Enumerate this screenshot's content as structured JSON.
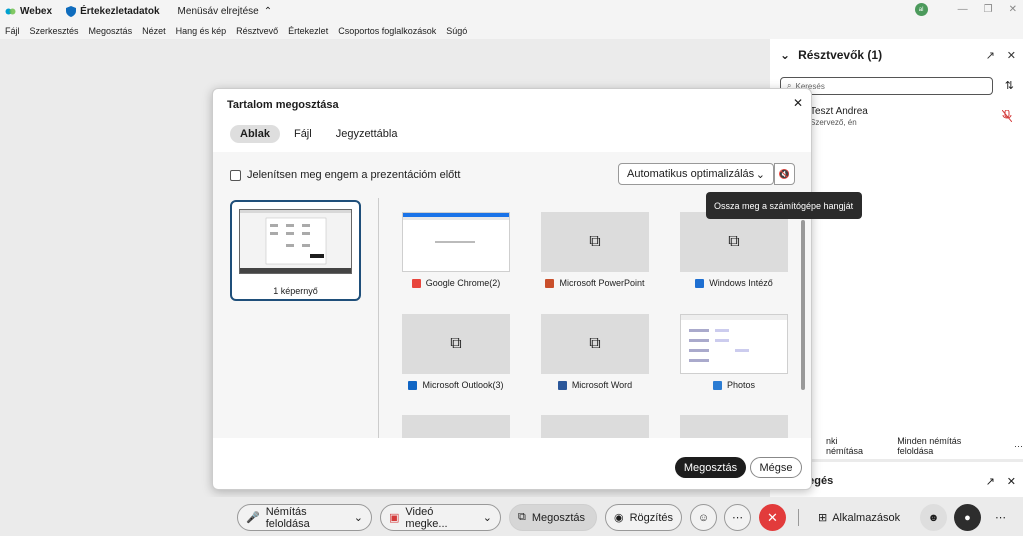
{
  "titlebar": {
    "app_name": "Webex",
    "meeting_label": "Értekezletadatok",
    "hide_menu_label": "Menüsáv elrejtése",
    "avatar_initials": "al"
  },
  "menu": [
    "Fájl",
    "Szerkesztés",
    "Megosztás",
    "Nézet",
    "Hang és kép",
    "Résztvevő",
    "Értekezlet",
    "Csoportos foglalkozások",
    "Súgó"
  ],
  "participants": {
    "title": "Résztvevők (1)",
    "search_placeholder": "Keresés",
    "items": [
      {
        "name": "Teszt Andrea",
        "role": "Szervező, én"
      }
    ],
    "mute_all": "nki némítása",
    "unmute_all": "Minden némítás feloldása",
    "more": "···"
  },
  "chat": {
    "title": "vegés"
  },
  "dialog": {
    "title": "Tartalom megosztása",
    "tabs": [
      "Ablak",
      "Fájl",
      "Jegyzettábla"
    ],
    "show_me_label": "Jelenítsen meg engem a prezentációm előtt",
    "optimize_label": "Automatikus optimalizálás",
    "tooltip": "Ossza meg a számítógépe hangját",
    "screen_label": "1 képernyő",
    "windows": [
      {
        "label": "Google Chrome(2)",
        "color": "#e8453c"
      },
      {
        "label": "Microsoft PowerPoint",
        "color": "#c94f2b"
      },
      {
        "label": "Windows Intéző",
        "color": "#1e6fd1"
      },
      {
        "label": "Microsoft Outlook(3)",
        "color": "#1065c4"
      },
      {
        "label": "Microsoft Word",
        "color": "#2b579a"
      },
      {
        "label": "Photos",
        "color": "#2b7cd3"
      }
    ],
    "share_label": "Megosztás",
    "cancel_label": "Mégse"
  },
  "toolbar": {
    "unmute": "Némítás feloldása",
    "video": "Videó megke...",
    "share": "Megosztás",
    "record": "Rögzítés",
    "apps": "Alkalmazások"
  }
}
